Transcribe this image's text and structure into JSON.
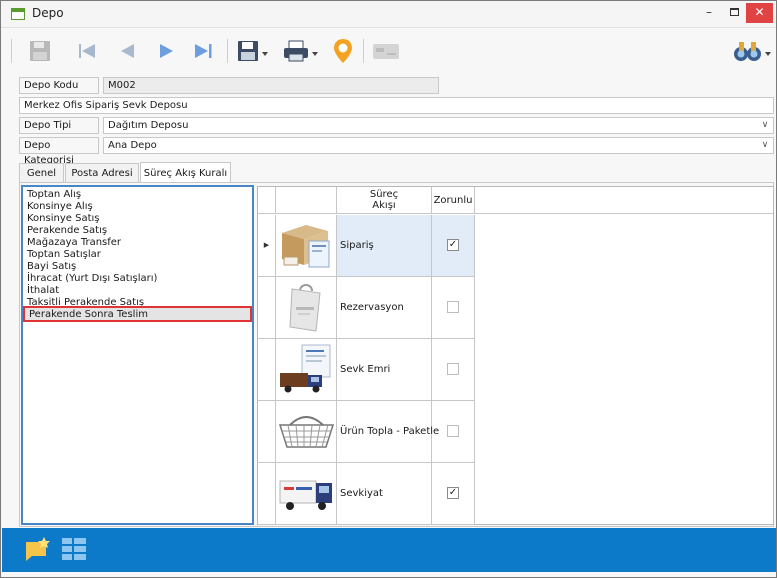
{
  "window": {
    "title": "Depo",
    "minimize": "–",
    "close": "✕"
  },
  "toolbar": {
    "buttons": [
      "save-icon",
      "first-record-icon",
      "previous-record-icon",
      "next-record-icon",
      "last-record-icon",
      "save-options-icon",
      "print-icon",
      "location-pin-icon",
      "card-icon",
      "find-binoculars-icon"
    ]
  },
  "fields": {
    "depo_kodu": {
      "label": "Depo Kodu",
      "value": "M002"
    },
    "description": {
      "value": "Merkez Ofis Sipariş Sevk Deposu"
    },
    "depo_tipi": {
      "label": "Depo Tipi",
      "value": "Dağıtım Deposu"
    },
    "depo_kategorisi": {
      "label": "Depo Kategorisi",
      "value": "Ana Depo"
    }
  },
  "tabs": [
    "Genel",
    "Posta Adresi",
    "Süreç Akış Kuralı"
  ],
  "process_list": {
    "items": [
      "Toptan Alış",
      "Konsinye Alış",
      "Konsinye Satış",
      "Perakende Satış",
      "Mağazaya Transfer",
      "Toptan Satışlar",
      "Bayi Satış",
      "İhracat (Yurt Dışı Satışları)",
      "İthalat",
      "Taksitli Perakende Satış"
    ],
    "selected": "Perakende Sonra Teslim"
  },
  "grid": {
    "headers": {
      "flow_line1": "Süreç",
      "flow_line2": "Akışı",
      "required": "Zorunlu"
    },
    "rows": [
      {
        "name": "Sipariş",
        "required": true,
        "current": true,
        "indicator": "▶",
        "icon": "order-box-icon"
      },
      {
        "name": "Rezervasyon",
        "required": false,
        "icon": "shopping-bag-icon"
      },
      {
        "name": "Sevk Emri",
        "required": false,
        "icon": "dispatch-order-truck-icon"
      },
      {
        "name": "Ürün Topla - Paketle",
        "required": false,
        "icon": "basket-icon"
      },
      {
        "name": "Sevkiyat",
        "required": true,
        "icon": "delivery-truck-icon"
      }
    ],
    "check_mark": "✓"
  },
  "bottom_bar": {
    "icons": [
      "new-note-icon",
      "grid-view-icon"
    ]
  },
  "colors": {
    "accent": "#0c7ac8",
    "close_button": "#e04343",
    "selection_border": "#e03333",
    "list_border": "#4a86c5",
    "current_row": "#e1ecf8"
  }
}
